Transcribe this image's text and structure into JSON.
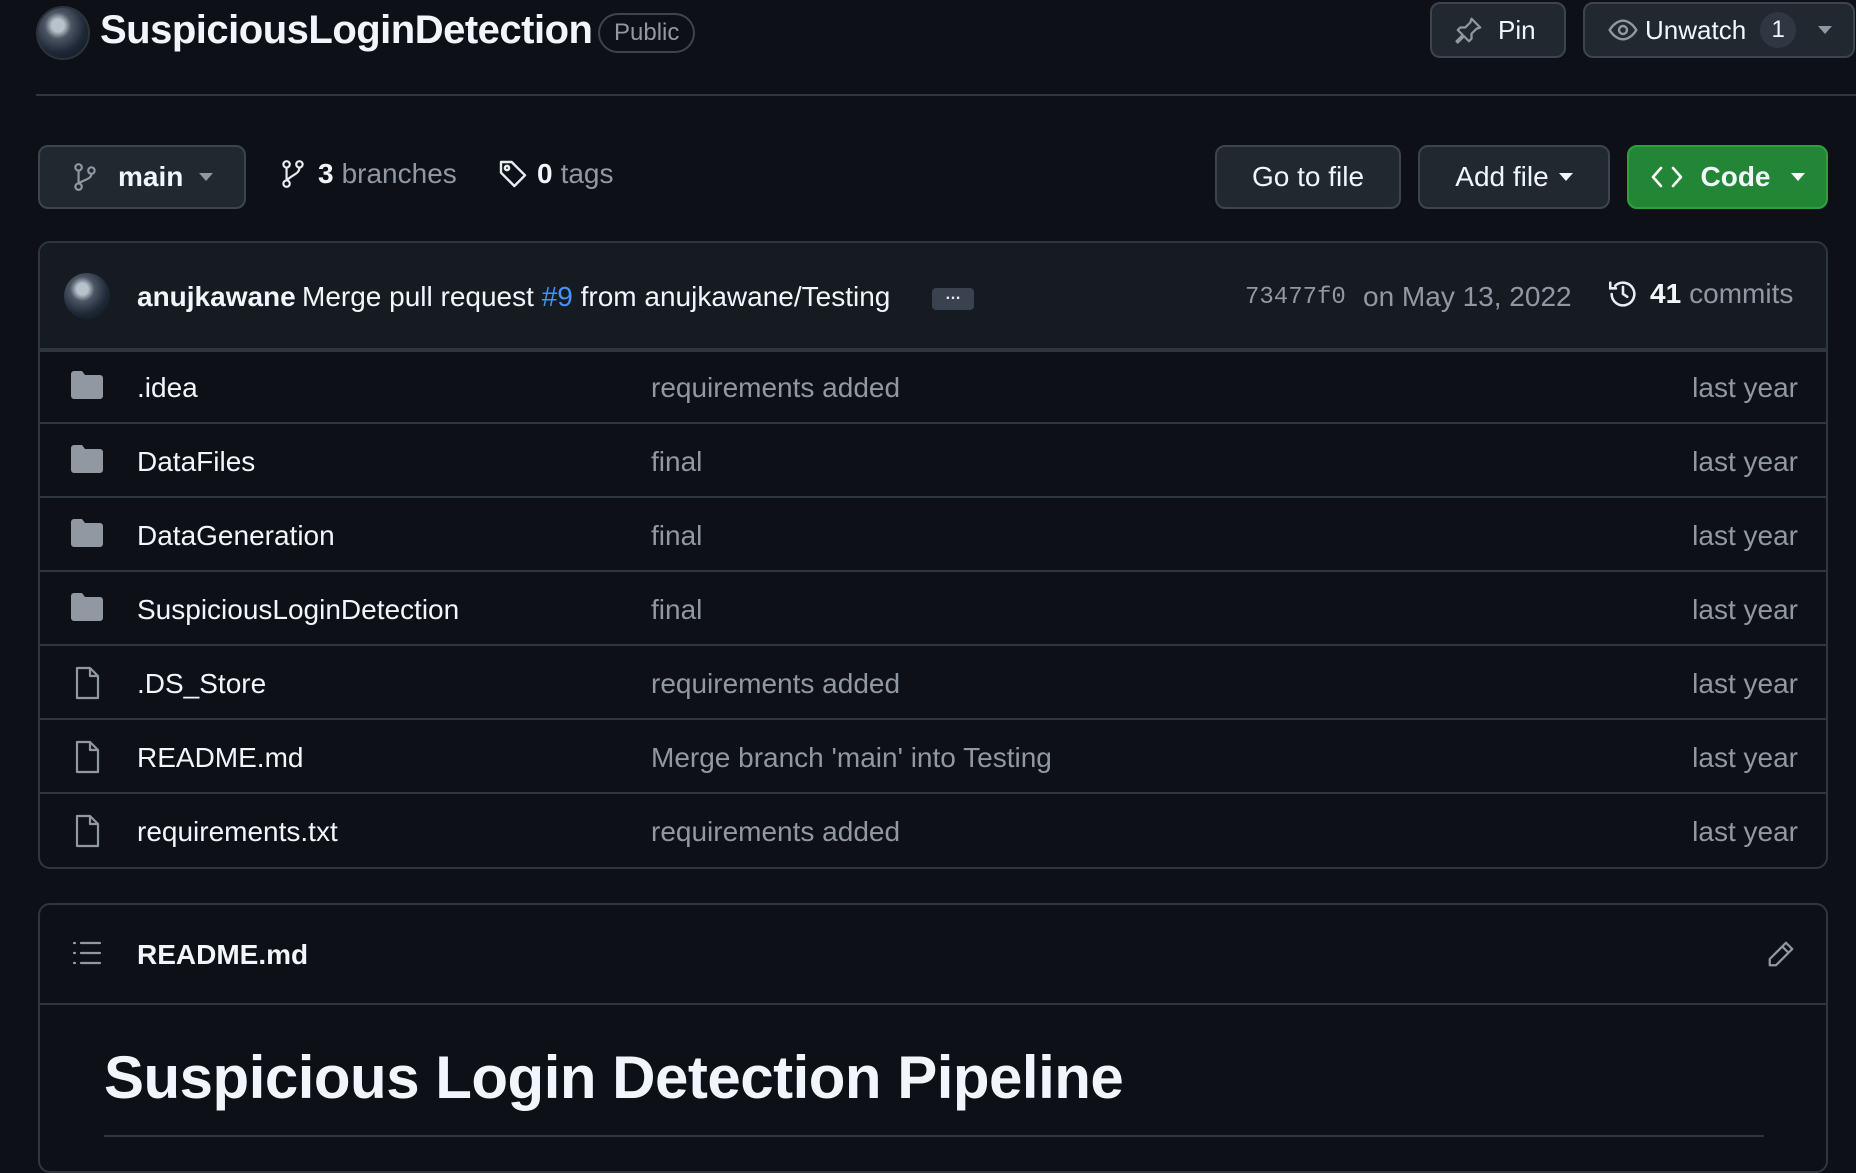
{
  "repo": {
    "name": "SuspiciousLoginDetection",
    "visibility": "Public",
    "pin_label": "Pin",
    "watch_label": "Unwatch",
    "watch_count": "1"
  },
  "toolbar": {
    "branch": "main",
    "branch_count": "3",
    "branches_label": "branches",
    "tag_count": "0",
    "tags_label": "tags",
    "go_to_file": "Go to file",
    "add_file": "Add file",
    "code": "Code"
  },
  "commit": {
    "author": "anujkawane",
    "message_prefix": "Merge pull request",
    "pr_number": "#9",
    "message_suffix": "from anujkawane/Testing",
    "ellipsis": "…",
    "sha": "73477f0",
    "date": "on May 13, 2022",
    "commit_count": "41",
    "commits_label": "commits"
  },
  "files": [
    {
      "type": "folder",
      "name": ".idea",
      "message": "requirements added",
      "age": "last year"
    },
    {
      "type": "folder",
      "name": "DataFiles",
      "message": "final",
      "age": "last year"
    },
    {
      "type": "folder",
      "name": "DataGeneration",
      "message": "final",
      "age": "last year"
    },
    {
      "type": "folder",
      "name": "SuspiciousLoginDetection",
      "message": "final",
      "age": "last year"
    },
    {
      "type": "file",
      "name": ".DS_Store",
      "message": "requirements added",
      "age": "last year"
    },
    {
      "type": "file",
      "name": "README.md",
      "message": "Merge branch 'main' into Testing",
      "age": "last year"
    },
    {
      "type": "file",
      "name": "requirements.txt",
      "message": "requirements added",
      "age": "last year"
    }
  ],
  "readme": {
    "filename": "README.md",
    "heading": "Suspicious Login Detection Pipeline"
  },
  "colors": {
    "background": "#0d1117",
    "border": "#30363d",
    "accent_green": "#238636",
    "link_blue": "#4493f8",
    "muted_text": "#9198a1"
  },
  "icons": {
    "pin": "pin-icon",
    "watch": "eye-icon",
    "branch": "git-branch-icon",
    "tag": "tag-icon",
    "code": "code-icon",
    "history": "history-icon",
    "folder": "folder-icon",
    "file": "file-icon",
    "list": "list-unordered-icon",
    "edit": "pencil-icon"
  }
}
